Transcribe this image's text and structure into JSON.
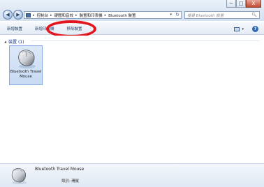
{
  "window": {
    "controls": {
      "minimize": "−",
      "maximize": "□",
      "close": "X"
    }
  },
  "nav": {
    "back": "◀",
    "forward": "▶",
    "dropdown": "▾"
  },
  "address": {
    "icon": "control-panel-icon",
    "crumbs": [
      "控制台",
      "硬體和音效",
      "裝置和印表機",
      "Bluetooth 裝置"
    ],
    "separator": "▸",
    "dropdown": "▾",
    "refresh": "↻"
  },
  "search": {
    "placeholder": "搜尋 Bluetooth 裝置",
    "icon": "search-icon"
  },
  "toolbar": {
    "add_device": "新增裝置",
    "add_printer": "新增印表機",
    "remove_device": "移除裝置",
    "view_dropdown": "▾",
    "help": "?"
  },
  "group": {
    "expander": "◢",
    "title": "裝置 (1)"
  },
  "device": {
    "name_line1": "Bluetooth Travel",
    "name_line2": "Mouse"
  },
  "details": {
    "name": "Bluetooth Travel Mouse",
    "category_label": "類別:",
    "category_value": "滑鼠"
  },
  "colors": {
    "highlight": "#e4141c",
    "selection": "#c7daf4",
    "toolbar_text": "#1e3a5c"
  }
}
